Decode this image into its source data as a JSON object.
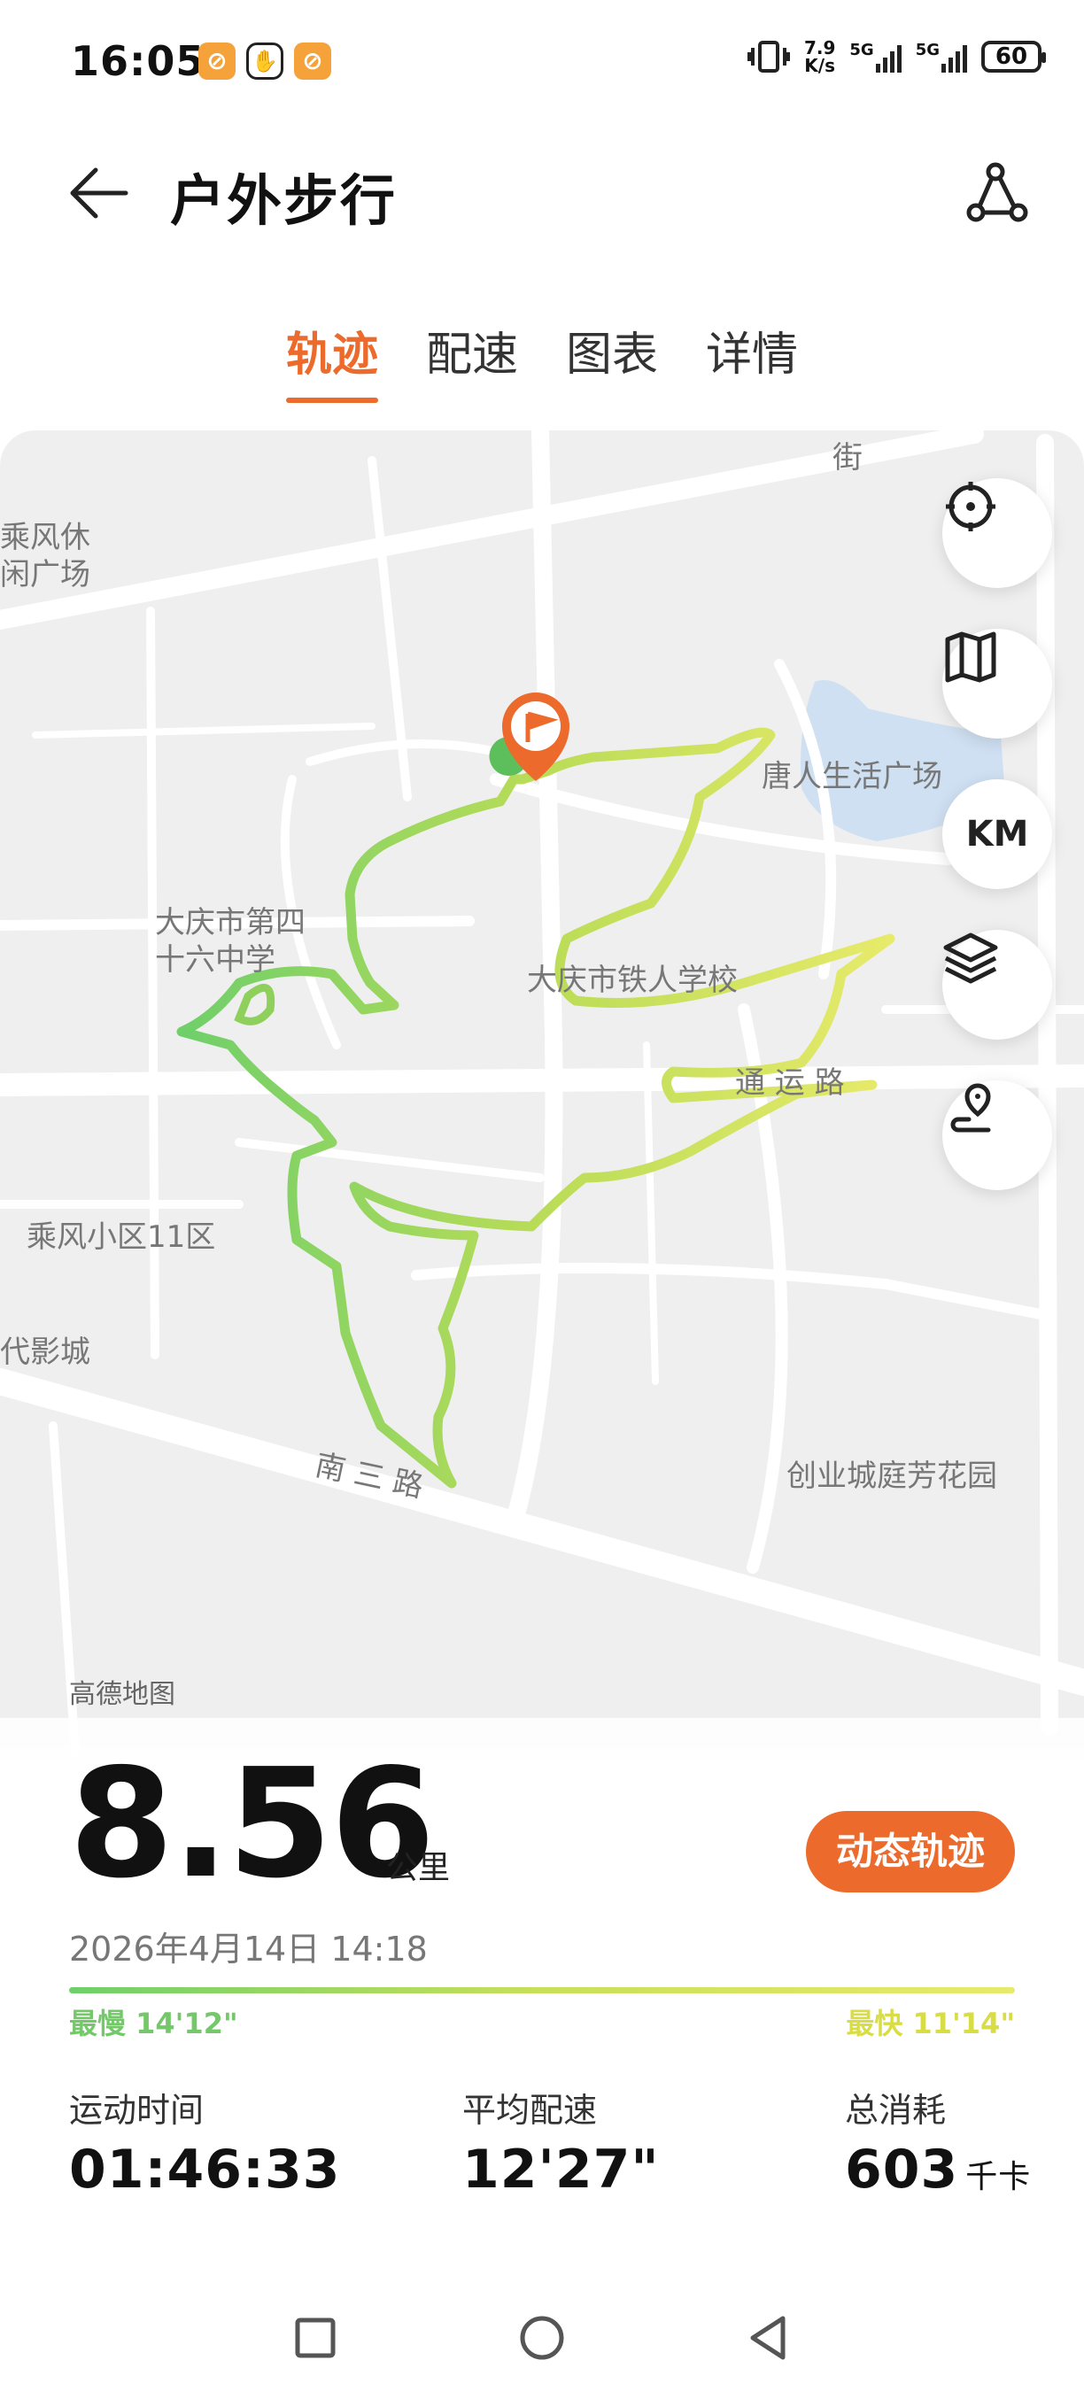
{
  "status_bar": {
    "time": "16:05",
    "speed_value": "7.9",
    "speed_unit": "K/s",
    "network_1": "5G",
    "network_2": "5G",
    "battery": "60"
  },
  "header": {
    "title": "户外步行"
  },
  "tabs": [
    {
      "label": "轨迹",
      "active": true
    },
    {
      "label": "配速",
      "active": false
    },
    {
      "label": "图表",
      "active": false
    },
    {
      "label": "详情",
      "active": false
    }
  ],
  "map": {
    "labels": {
      "plaza_top_left": "乘风休\n闲广场",
      "street_top": "街",
      "tangren_plaza": "唐人生活广场",
      "school_46": "大庆市第四\n十六中学",
      "tieren_school": "大庆市铁人学校",
      "tongyun_road": "通 运 路",
      "chengfeng_district": "乘风小区11区",
      "cinema": "代影城",
      "nansan_road": "南 三 路",
      "chuangye_garden": "创业城庭芳花园"
    },
    "controls": {
      "locate": "locate-icon",
      "map_type": "map-icon",
      "km_marker": "KM",
      "layers": "layers-icon",
      "route_marker": "route-pin-icon"
    },
    "credit": "高德地图"
  },
  "summary": {
    "distance": "8.56",
    "distance_unit": "公里",
    "dynamic_track_button": "动态轨迹",
    "datetime": "2026年4月14日 14:18",
    "slowest": "最慢 14'12\"",
    "fastest": "最快 11'14\"",
    "duration_label": "运动时间",
    "duration_value": "01:46:33",
    "avg_pace_label": "平均配速",
    "avg_pace_value": "12'27\"",
    "calories_label": "总消耗",
    "calories_value": "603",
    "calories_unit": "千卡"
  },
  "colors": {
    "accent": "#ec6a2b",
    "track_slow": "#6fcf6a",
    "track_fast": "#e7ea6a"
  }
}
